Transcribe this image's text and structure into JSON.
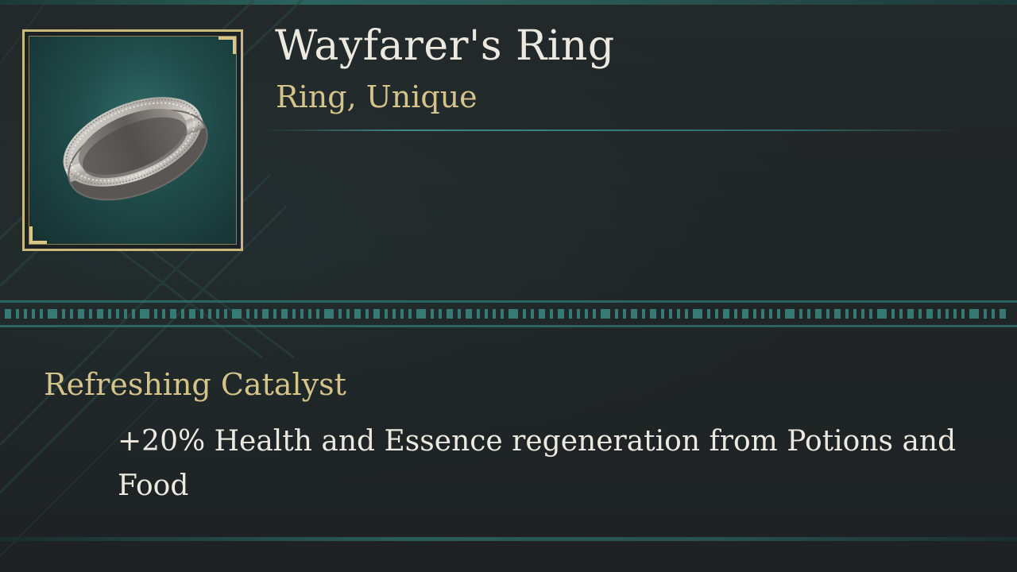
{
  "item": {
    "name": "Wayfarer's Ring",
    "type": "Ring, Unique",
    "icon": "ring-icon"
  },
  "trait": {
    "name": "Refreshing Catalyst",
    "description": "+20% Health and Essence regeneration from Potions and Food"
  },
  "colors": {
    "background": "#202526",
    "accent_teal": "#2f7a72",
    "gold": "#d4c38a",
    "frame_gold": "#c9b97a",
    "text_light": "#ece9e0"
  }
}
